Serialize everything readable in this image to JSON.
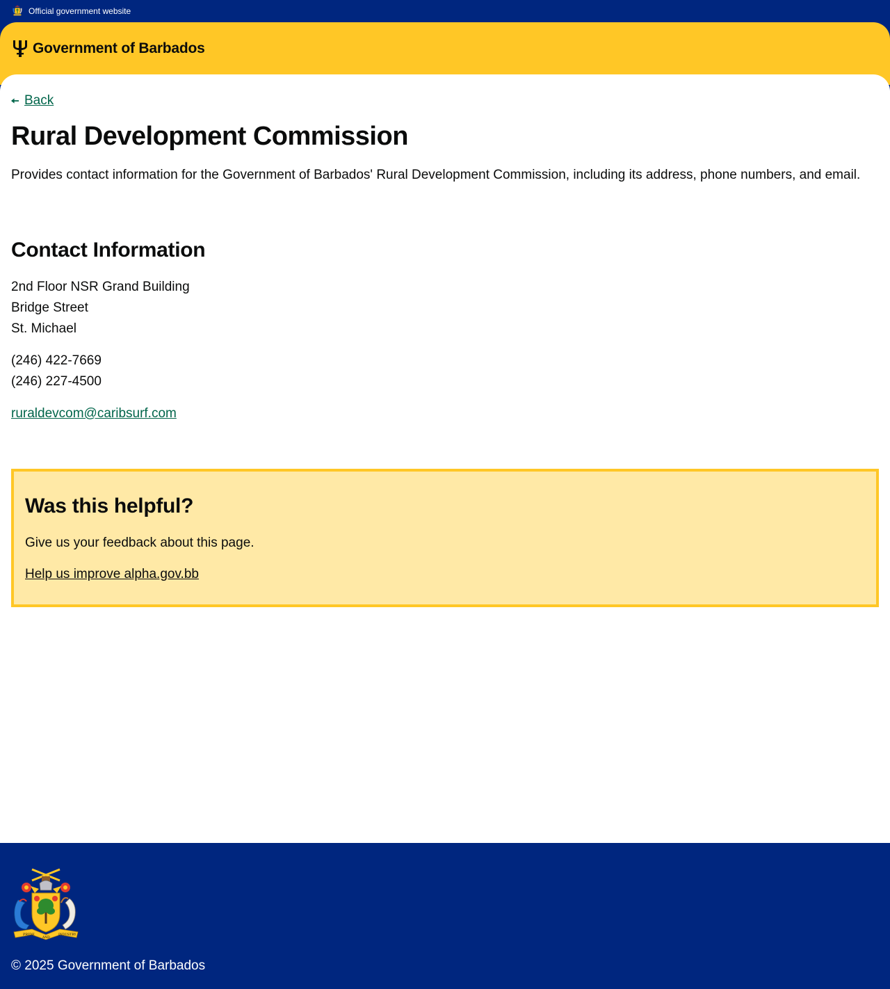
{
  "top_strip": {
    "label": "Official government website"
  },
  "header": {
    "brand_name": "Government of Barbados"
  },
  "main": {
    "back_label": "Back",
    "title": "Rural Development Commission",
    "lead": "Provides contact information for the Government of Barbados' Rural Development Commission, including its address, phone numbers, and email.",
    "contact_heading": "Contact Information",
    "address": [
      "2nd Floor NSR Grand Building",
      "Bridge Street",
      "St. Michael"
    ],
    "phones": [
      "(246) 422-7669",
      "(246) 227-4500"
    ],
    "email": "ruraldevcom@caribsurf.com"
  },
  "feedback": {
    "heading": "Was this helpful?",
    "text": "Give us your feedback about this page.",
    "link": "Help us improve alpha.gov.bb"
  },
  "footer": {
    "copyright": "© 2025 Government of Barbados",
    "coat_of_arms_motto": [
      "PRIDE",
      "AND",
      "INDUSTRY"
    ]
  },
  "colors": {
    "navy": "#00267f",
    "gold": "#ffc726",
    "pale_gold": "#ffe9a6",
    "link_green": "#00654a",
    "text": "#0b0c0c"
  },
  "icons": [
    "coat-of-arms-icon",
    "trident-icon",
    "back-arrow-icon"
  ]
}
